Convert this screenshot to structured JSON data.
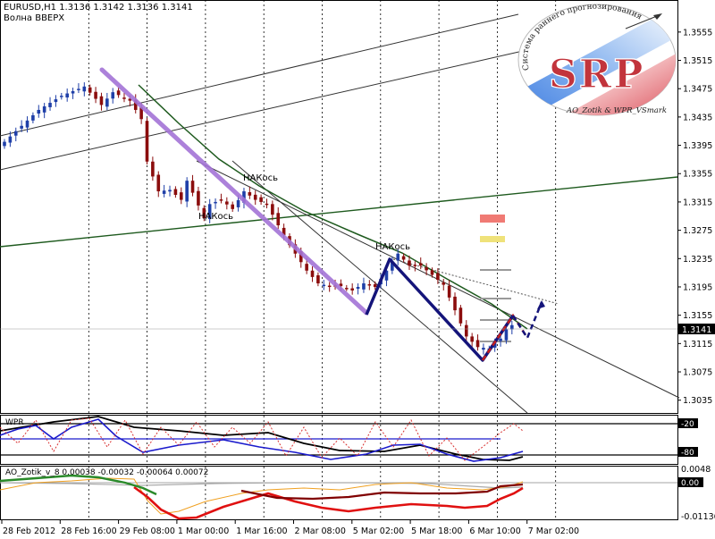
{
  "header": {
    "symbol_line": "EURUSD,H1  1.3136 1.3142 1.3136 1.3141",
    "subtitle": "Волна ВВЕРХ"
  },
  "logo": {
    "arc_text": "Система раннего прогнозирования",
    "letters": "SRP",
    "footer": "AO_Zotik & WPR_VSmark"
  },
  "annotations": [
    "НАКось",
    "НАКось",
    "НАКось"
  ],
  "wpr_panel": {
    "label": "WPR",
    "ticks": [
      "-20",
      "-80"
    ]
  },
  "ao_panel": {
    "label": "AO_Zotik_v_8  0.00038 -0.00032 -0.00064 0.00072",
    "ticks": [
      "0.0048",
      "0.00",
      "-0.01136"
    ]
  },
  "colors": {
    "bull": "#1f3fa8",
    "bear": "#8b0d0d",
    "purple_line": "#a474d6",
    "navy_zigzag": "#14147a",
    "green_line": "#1e5a1e",
    "logo_red": "#c2343c"
  },
  "chart_data": {
    "type": "candlestick",
    "title": "EURUSD,H1",
    "y_ticks": [
      "1.3555",
      "1.3515",
      "1.3475",
      "1.3435",
      "1.3395",
      "1.3355",
      "1.3315",
      "1.3275",
      "1.3235",
      "1.3195",
      "1.3155",
      "1.3115",
      "1.3075",
      "1.3035"
    ],
    "ylim": [
      1.3022,
      1.3575
    ],
    "x_ticks": [
      "28 Feb 2012",
      "28 Feb 16:00",
      "29 Feb 08:00",
      "1 Mar 00:00",
      "1 Mar 16:00",
      "2 Mar 08:00",
      "5 Mar 02:00",
      "5 Mar 18:00",
      "6 Mar 10:00",
      "7 Mar 02:00"
    ],
    "current_price": "1.3141",
    "close_path": [
      [
        0,
        1.34
      ],
      [
        6,
        1.3445
      ],
      [
        10,
        1.3465
      ],
      [
        14,
        1.3478
      ],
      [
        17,
        1.3452
      ],
      [
        19,
        1.347
      ],
      [
        22,
        1.3458
      ],
      [
        24,
        1.3432
      ],
      [
        25,
        1.3372
      ],
      [
        27,
        1.333
      ],
      [
        29,
        1.3332
      ],
      [
        31,
        1.3318
      ],
      [
        32,
        1.3345
      ],
      [
        33,
        1.3328
      ],
      [
        35,
        1.3292
      ],
      [
        36,
        1.3312
      ],
      [
        38,
        1.3318
      ],
      [
        40,
        1.3305
      ],
      [
        42,
        1.333
      ],
      [
        44,
        1.3318
      ],
      [
        46,
        1.3312
      ],
      [
        48,
        1.3282
      ],
      [
        50,
        1.3254
      ],
      [
        53,
        1.3218
      ],
      [
        55,
        1.32
      ],
      [
        57,
        1.3196
      ],
      [
        59,
        1.3196
      ],
      [
        61,
        1.319
      ],
      [
        63,
        1.32
      ],
      [
        65,
        1.3195
      ],
      [
        67,
        1.3218
      ],
      [
        69,
        1.3242
      ],
      [
        71,
        1.3225
      ],
      [
        73,
        1.3225
      ],
      [
        75,
        1.3212
      ],
      [
        77,
        1.3198
      ],
      [
        79,
        1.3162
      ],
      [
        81,
        1.3125
      ],
      [
        83,
        1.311
      ],
      [
        85,
        1.3108
      ],
      [
        87,
        1.3122
      ],
      [
        88,
        1.3135
      ],
      [
        89,
        1.3141
      ]
    ],
    "current_index": 89
  }
}
